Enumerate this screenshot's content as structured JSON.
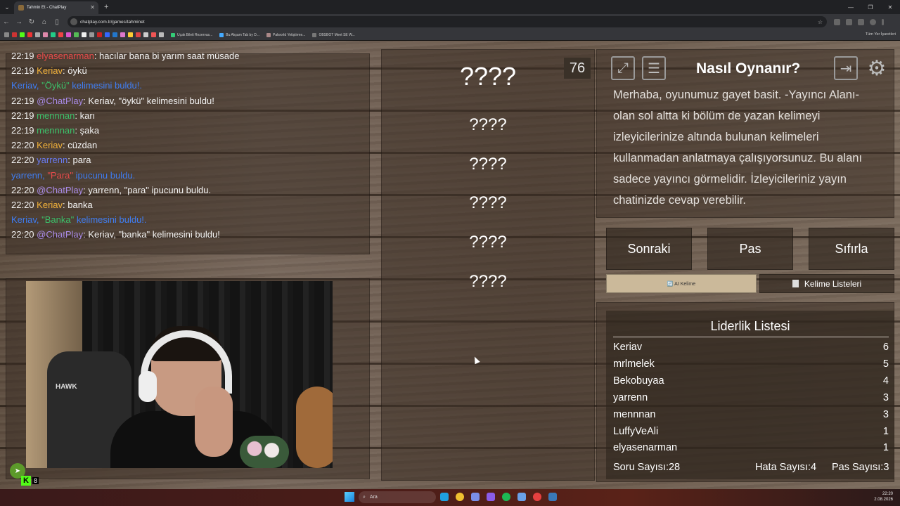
{
  "browser": {
    "tab_title": "Tahmin Et - ChatPlay",
    "url": "chatplay.com.tr/games/tahminet",
    "bookmarks": [
      "Uçak Bileti Rezervas...",
      "Bu Akşam Tab by D...",
      "Palworld Yetiştirme...",
      "OBSBOT Meet SE W..."
    ],
    "bookmarks_right": "Tüm Yer İşaretleri"
  },
  "chat": {
    "lines": [
      {
        "time": "22:19",
        "user": "elyasenarman",
        "text": ": hacılar bana bi yarım saat müsade",
        "color": "#e84b4b"
      },
      {
        "time": "22:19",
        "user": "Keriav",
        "text": ": öykü",
        "color": "#f2b23a"
      },
      {
        "pre": "Keriav, ",
        "word": "\"Öykü\"",
        "post": " kelimesini buldu!.",
        "system": true,
        "word_color": "green"
      },
      {
        "time": "22:19",
        "user": "@ChatPlay",
        "text": ": Keriav, \"öykü\" kelimesini buldu!",
        "color": "#a98be8"
      },
      {
        "time": "22:19",
        "user": "mennnan",
        "text": ": karı",
        "color": "#3cc06a"
      },
      {
        "time": "22:19",
        "user": "mennnan",
        "text": ": şaka",
        "color": "#3cc06a"
      },
      {
        "time": "22:20",
        "user": "Keriav",
        "text": ": cüzdan",
        "color": "#f2b23a"
      },
      {
        "time": "22:20",
        "user": "yarrenn",
        "text": ": para",
        "color": "#6a7cf2"
      },
      {
        "pre": "yarrenn, ",
        "word": "\"Para\"",
        "post": " ipucunu buldu.",
        "system": true,
        "word_color": "red"
      },
      {
        "time": "22:20",
        "user": "@ChatPlay",
        "text": ": yarrenn, \"para\" ipucunu buldu.",
        "color": "#a98be8"
      },
      {
        "time": "22:20",
        "user": "Keriav",
        "text": ": banka",
        "color": "#f2b23a"
      },
      {
        "pre": "Keriav, ",
        "word": "\"Banka\"",
        "post": " kelimesini buldu!.",
        "system": true,
        "word_color": "green"
      },
      {
        "time": "22:20",
        "user": "@ChatPlay",
        "text": ": Keriav, \"banka\" kelimesini buldu!",
        "color": "#a98be8"
      }
    ]
  },
  "webcam": {
    "chair_logo": "HAWK"
  },
  "game": {
    "main_word": "????",
    "hint_words": [
      "????",
      "????",
      "????",
      "????",
      "????"
    ],
    "timer": "76"
  },
  "howto": {
    "title": "Nasıl Oynanır?",
    "text": "Merhaba, oyunumuz gayet basit. -Yayıncı Alanı- olan sol altta ki bölüm de yazan kelimeyi izleyicilerinize altında bulunan kelimeleri kullanmadan anlatmaya çalışıyorsunuz. Bu alanı sadece yayıncı görmelidir. İzleyicileriniz yayın chatinizde cevap verebilir.",
    "icons": [
      "fullscreen-icon",
      "list-icon",
      "exit-icon",
      "settings-icon"
    ]
  },
  "controls": {
    "next": "Sonraki",
    "pass": "Pas",
    "reset": "Sıfırla",
    "ai_word": "🔄 AI Kelime",
    "word_lists": "Kelime Listeleri"
  },
  "leaderboard": {
    "title": "Liderlik Listesi",
    "rows": [
      {
        "name": "Keriav",
        "score": "6"
      },
      {
        "name": "mrlmelek",
        "score": "5"
      },
      {
        "name": "Bekobuyaa",
        "score": "4"
      },
      {
        "name": "yarrenn",
        "score": "3"
      },
      {
        "name": "mennnan",
        "score": "3"
      },
      {
        "name": "LuffyVeAli",
        "score": "1"
      },
      {
        "name": "elyasenarman",
        "score": "1"
      }
    ],
    "questions_label": "Soru Sayısı:",
    "questions": "28",
    "errors_label": "Hata Sayısı:",
    "errors": "4",
    "passes_label": "Pas Sayısı:",
    "passes": "3"
  },
  "overlay": {
    "kick_count": "8"
  },
  "taskbar": {
    "search": "Ara",
    "time": "22:20",
    "date": "2.08.2026"
  }
}
